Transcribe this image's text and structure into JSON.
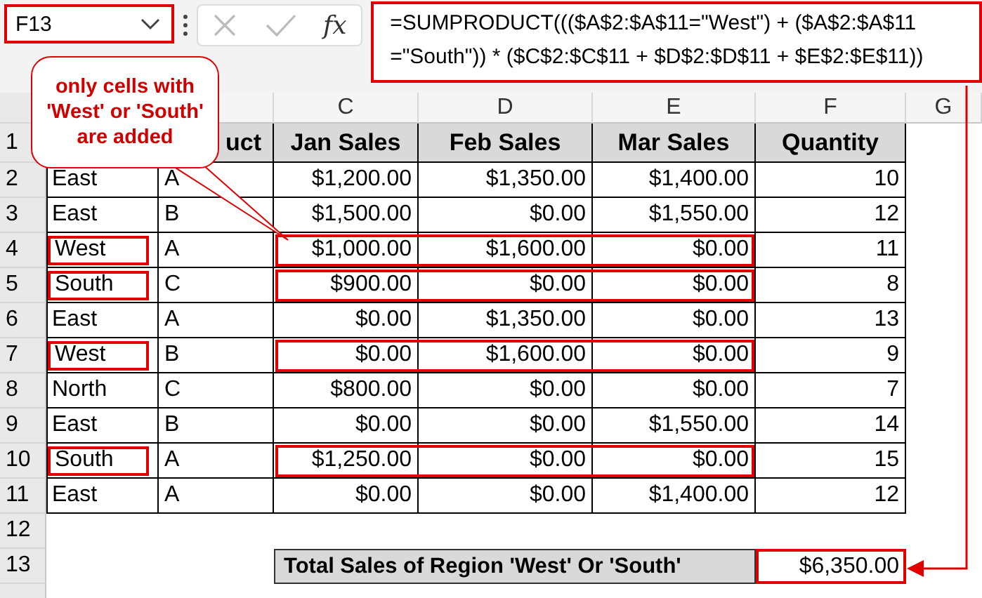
{
  "name_box": {
    "value": "F13"
  },
  "formula_bar": {
    "function_label": "fx",
    "formula": "=SUMPRODUCT((($A$2:$A$11=\"West\") + ($A$2:$A$11 =\"South\")) * ($C$2:$C$11 + $D$2:$D$11 + $E$2:$E$11))"
  },
  "callout": {
    "text": "only cells with 'West' or 'South' are added"
  },
  "column_letters": [
    "C",
    "D",
    "E",
    "F",
    "G"
  ],
  "header_row": {
    "number": "1",
    "product": "uct",
    "jan": "Jan Sales",
    "feb": "Feb Sales",
    "mar": "Mar Sales",
    "quantity": "Quantity"
  },
  "rows": [
    {
      "number": "2",
      "region": "East",
      "product": "A",
      "jan": "$1,200.00",
      "feb": "$1,350.00",
      "mar": "$1,400.00",
      "quantity": "10",
      "highlighted": false
    },
    {
      "number": "3",
      "region": "East",
      "product": "B",
      "jan": "$1,500.00",
      "feb": "$0.00",
      "mar": "$1,550.00",
      "quantity": "12",
      "highlighted": false
    },
    {
      "number": "4",
      "region": "West",
      "product": "A",
      "jan": "$1,000.00",
      "feb": "$1,600.00",
      "mar": "$0.00",
      "quantity": "11",
      "highlighted": true
    },
    {
      "number": "5",
      "region": "South",
      "product": "C",
      "jan": "$900.00",
      "feb": "$0.00",
      "mar": "$0.00",
      "quantity": "8",
      "highlighted": true
    },
    {
      "number": "6",
      "region": "East",
      "product": "A",
      "jan": "$0.00",
      "feb": "$1,350.00",
      "mar": "$0.00",
      "quantity": "13",
      "highlighted": false
    },
    {
      "number": "7",
      "region": "West",
      "product": "B",
      "jan": "$0.00",
      "feb": "$1,600.00",
      "mar": "$0.00",
      "quantity": "9",
      "highlighted": true
    },
    {
      "number": "8",
      "region": "North",
      "product": "C",
      "jan": "$800.00",
      "feb": "$0.00",
      "mar": "$0.00",
      "quantity": "7",
      "highlighted": false
    },
    {
      "number": "9",
      "region": "East",
      "product": "B",
      "jan": "$0.00",
      "feb": "$0.00",
      "mar": "$1,550.00",
      "quantity": "14",
      "highlighted": false
    },
    {
      "number": "10",
      "region": "South",
      "product": "A",
      "jan": "$1,250.00",
      "feb": "$0.00",
      "mar": "$0.00",
      "quantity": "15",
      "highlighted": true
    },
    {
      "number": "11",
      "region": "East",
      "product": "A",
      "jan": "$0.00",
      "feb": "$0.00",
      "mar": "$1,400.00",
      "quantity": "12",
      "highlighted": false
    }
  ],
  "empty_row": {
    "number": "12"
  },
  "total_row": {
    "number": "13",
    "label": "Total Sales of Region 'West' Or 'South'",
    "value": "$6,350.00"
  }
}
